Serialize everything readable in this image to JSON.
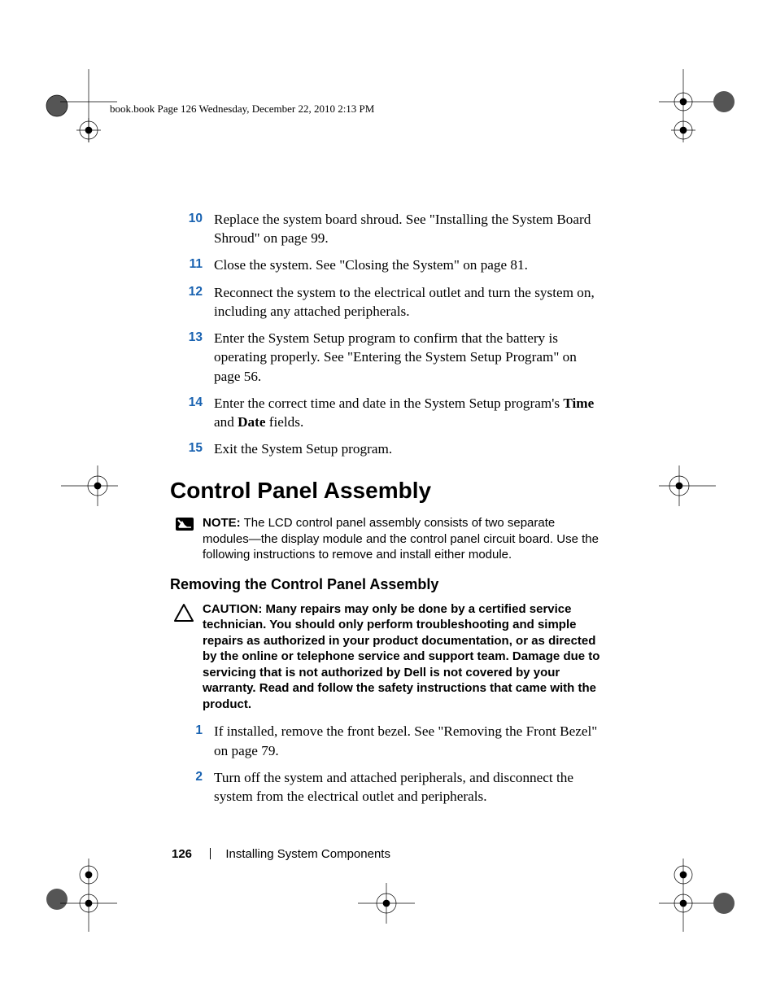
{
  "header": "book.book  Page 126  Wednesday, December 22, 2010  2:13 PM",
  "steps_a": [
    {
      "n": "10",
      "html": "Replace the system board shroud. See \"Installing the System Board Shroud\" on page 99."
    },
    {
      "n": "11",
      "html": "Close the system. See \"Closing the System\" on page 81."
    },
    {
      "n": "12",
      "html": "Reconnect the system to the electrical outlet and turn the system on, including any attached peripherals."
    },
    {
      "n": "13",
      "html": "Enter the System Setup program to confirm that the battery is operating properly. See \"Entering the System Setup Program\" on page 56."
    },
    {
      "n": "14",
      "html": "Enter the correct time and date in the System Setup program's <b>Time</b> and <b>Date</b> fields."
    },
    {
      "n": "15",
      "html": "Exit the System Setup program."
    }
  ],
  "heading1": "Control Panel Assembly",
  "note_label": "NOTE:",
  "note_text": " The LCD control panel assembly consists of two separate modules—the display module and the control panel circuit board. Use the following instructions to remove and install either module.",
  "heading2": "Removing the Control Panel Assembly",
  "caution_label": "CAUTION:",
  "caution_text": " Many repairs may only be done by a certified service technician. You should only perform troubleshooting and simple repairs as authorized in your product documentation, or as directed by the online or telephone service and support team. Damage due to servicing that is not authorized by Dell is not covered by your warranty. Read and follow the safety instructions that came with the product.",
  "steps_b": [
    {
      "n": "1",
      "html": "If installed, remove the front bezel. See \"Removing the Front Bezel\" on page 79."
    },
    {
      "n": "2",
      "html": "Turn off the system and attached peripherals, and disconnect the system from the electrical outlet and peripherals."
    }
  ],
  "footer": {
    "page": "126",
    "section": "Installing System Components"
  }
}
